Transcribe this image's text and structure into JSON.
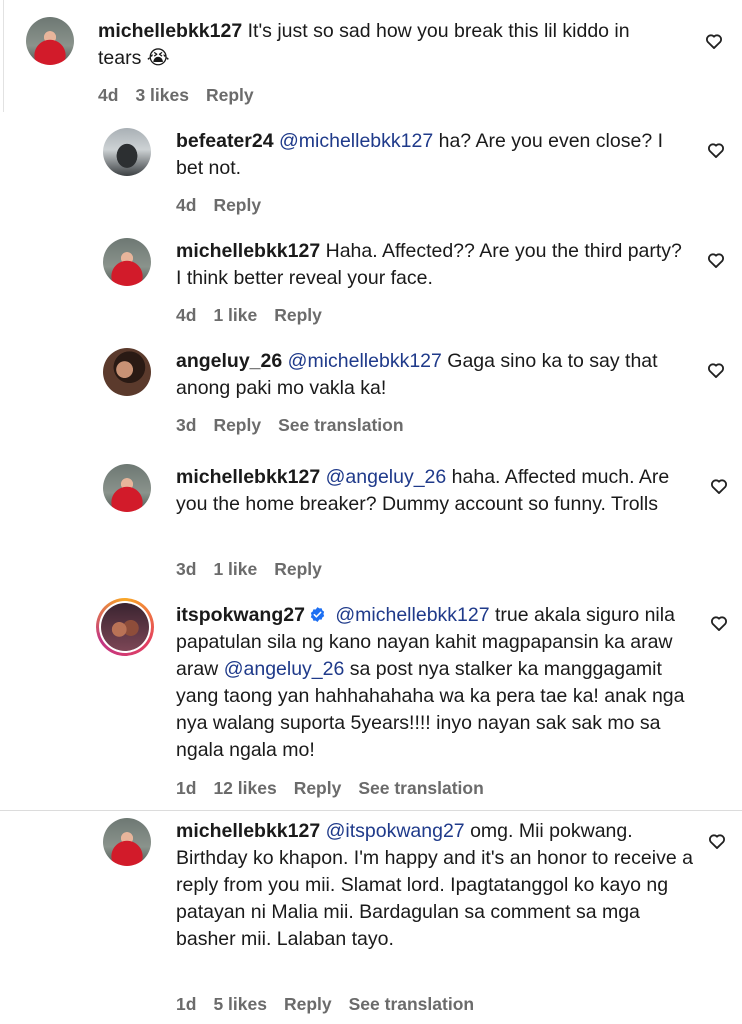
{
  "comments": [
    {
      "username": "michellebkk127",
      "mention": "",
      "text": "It's just so sad how you break this lil kiddo in tears 😭",
      "meta": {
        "time": "4d",
        "likes": "3 likes",
        "reply": "Reply",
        "translation": ""
      }
    },
    {
      "username": "befeater24",
      "mention": "@michellebkk127",
      "text": "ha? Are you even close? I bet not.",
      "meta": {
        "time": "4d",
        "likes": "",
        "reply": "Reply",
        "translation": ""
      }
    },
    {
      "username": "michellebkk127",
      "mention": "",
      "text": "Haha. Affected?? Are you the third party? I think better reveal your face.",
      "meta": {
        "time": "4d",
        "likes": "1 like",
        "reply": "Reply",
        "translation": ""
      }
    },
    {
      "username": "angeluy_26",
      "mention": "@michellebkk127",
      "text": "Gaga sino ka to say that anong paki mo vakla ka!",
      "meta": {
        "time": "3d",
        "likes": "",
        "reply": "Reply",
        "translation": "See translation"
      }
    },
    {
      "username": "michellebkk127",
      "mention": "@angeluy_26",
      "text": "haha. Affected much. Are you the home breaker? Dummy account so funny. Trolls",
      "meta": {
        "time": "3d",
        "likes": "1 like",
        "reply": "Reply",
        "translation": ""
      }
    },
    {
      "username": "itspokwang27",
      "mention": "@michellebkk127",
      "text": "true akala siguro nila papatulan sila ng kano nayan kahit magpapansin ka araw araw",
      "mention2": "@angeluy_26",
      "text2": "sa post nya stalker ka manggagamit yang taong yan hahhahahaha wa ka pera tae ka! anak nga nya walang suporta 5years!!!! inyo nayan sak sak mo sa ngala ngala mo!",
      "meta": {
        "time": "1d",
        "likes": "12 likes",
        "reply": "Reply",
        "translation": "See translation"
      }
    },
    {
      "username": "michellebkk127",
      "mention": "@itspokwang27",
      "text": "omg. Mii pokwang. Birthday ko khapon. I'm happy and it's an honor to receive a reply from you mii. Slamat lord. Ipagtatanggol ko kayo ng patayan ni Malia mii. Bardagulan sa comment sa mga basher mii. Lalaban tayo.",
      "meta": {
        "time": "1d",
        "likes": "5 likes",
        "reply": "Reply",
        "translation": "See translation"
      }
    }
  ],
  "icons": {
    "like": "heart-outline-icon",
    "verified": "verified-badge-icon"
  },
  "colors": {
    "mention": "#1f3a8a",
    "meta": "#6b6b6b",
    "verified": "#1d9bf0"
  }
}
